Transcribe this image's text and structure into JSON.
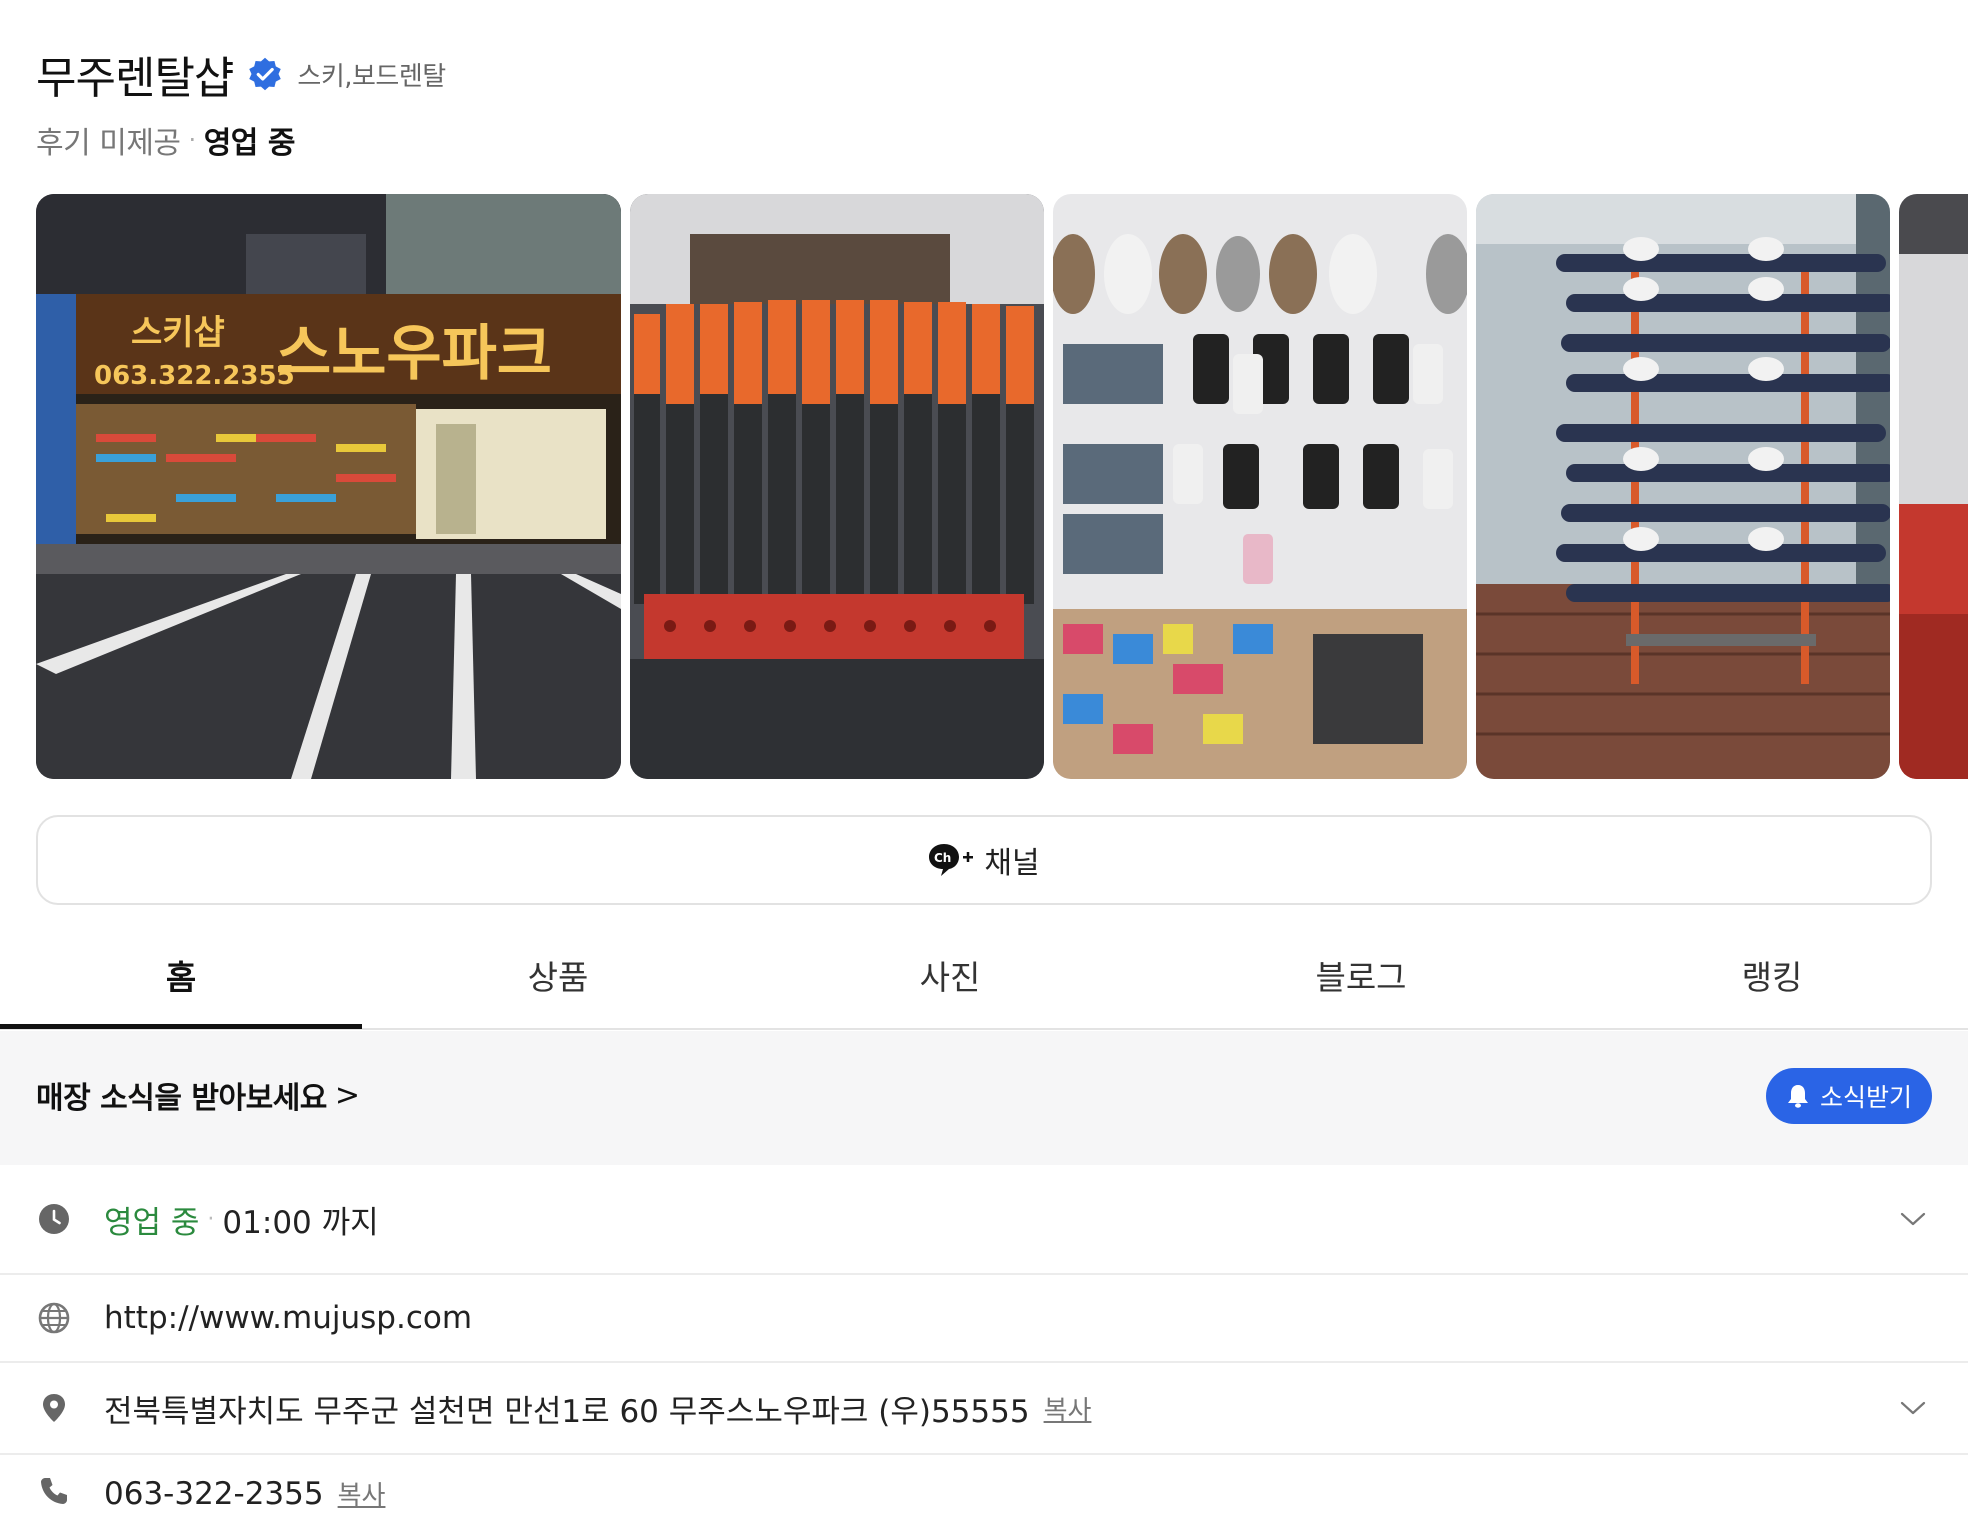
{
  "store": {
    "name": "무주렌탈샵",
    "category": "스키,보드렌탈",
    "reviews": "후기 미제공",
    "status": "영업 중"
  },
  "gallery": {
    "photo1": {
      "sign_top": "스키샵",
      "sign_phone": "063.322.2355",
      "sign_main": "스노우파크"
    }
  },
  "channel": {
    "icon_text": "Ch",
    "label": "채널"
  },
  "tabs": [
    "홈",
    "상품",
    "사진",
    "블로그",
    "랭킹"
  ],
  "news": {
    "text": "매장 소식을 받아보세요",
    "chevron": ">",
    "button": "소식받기"
  },
  "info": {
    "hours_status": "영업 중",
    "hours_until": "01:00 까지",
    "website": "http://www.mujusp.com",
    "address": "전북특별자치도 무주군 설천면 만선1로 60 무주스노우파크 (우)55555",
    "address_copy": "복사",
    "phone": "063-322-2355",
    "phone_copy": "복사"
  },
  "colors": {
    "accent_blue": "#2a64e6",
    "open_green": "#2b8a3e",
    "link_blue": "#2f5fc4",
    "verified_blue": "#2f6ee0"
  }
}
